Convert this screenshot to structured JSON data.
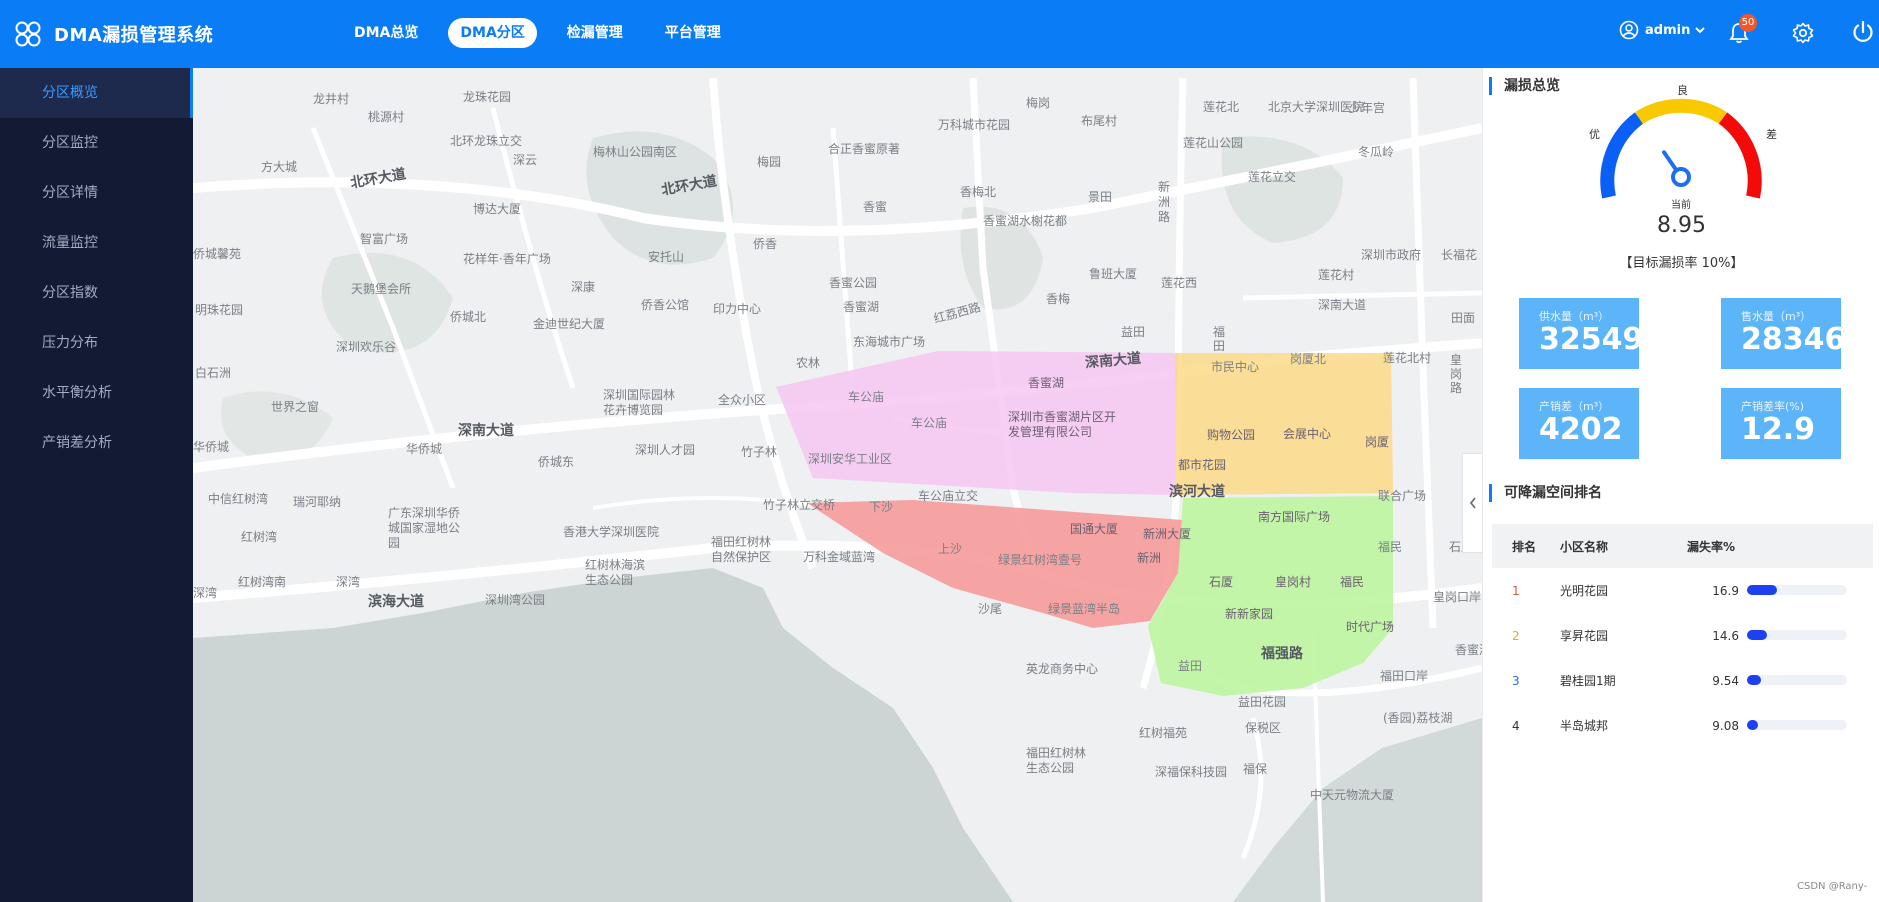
{
  "header": {
    "title": "DMA漏损管理系统",
    "nav": [
      "DMA总览",
      "DMA分区",
      "检漏管理",
      "平台管理"
    ],
    "active_nav": "DMA分区",
    "user": "admin",
    "notification_count": "50"
  },
  "sidebar": {
    "items": [
      "分区概览",
      "分区监控",
      "分区详情",
      "流量监控",
      "分区指数",
      "压力分布",
      "水平衡分析",
      "产销差分析"
    ],
    "active": "分区概览"
  },
  "map": {
    "labels": {
      "l1": "龙井村",
      "l2": "龙珠花园",
      "l3": "桃源村",
      "l4": "北环龙珠立交",
      "l5": "深云",
      "l6": "方大城",
      "l7": "北环大道",
      "l8": "博达大厦",
      "l9": "智富广场",
      "l10": "花样年·香年广场",
      "l11": "天鹅堡会所",
      "l12": "侨城北",
      "l13": "金迪世纪大厦",
      "l14": "深圳欢乐谷",
      "l15": "世界之窗",
      "l16": "深南大道",
      "l17": "华侨城",
      "l18": "侨城东",
      "l19": "中信红树湾",
      "l20": "瑞河耶纳",
      "l21": "红树湾",
      "l22": "广东深圳华侨城国家湿地公园",
      "l23": "红树湾南",
      "l24": "深湾",
      "l25": "滨海大道",
      "l26": "深圳湾公园",
      "l27": "香港大学深圳医院",
      "l28": "红树林海滨生态公园",
      "l29": "福田红树林自然保护区",
      "l30": "万科金域蓝湾",
      "l31": "竹子林立交桥",
      "l32": "梅林山公园南区",
      "l33": "梅园",
      "l34": "合正香蜜原著",
      "l35": "北环大道",
      "l36": "万科城市花园",
      "l37": "梅岗",
      "l38": "布尾村",
      "l39": "香蜜",
      "l40": "香梅北",
      "l41": "香蜜湖水榭花都",
      "l42": "景田",
      "l43": "新洲路",
      "l44": "安托山",
      "l45": "侨香",
      "l46": "深康",
      "l47": "侨香公馆",
      "l48": "印力中心",
      "l49": "香蜜公园",
      "l50": "香蜜湖",
      "l51": "红荔西路",
      "l52": "鲁班大厦",
      "l53": "香梅",
      "l54": "莲花西",
      "l55": "东海城市广场",
      "l56": "农林",
      "l57": "车公庙",
      "l58": "深圳国际园林花卉博览园",
      "l59": "全众小区",
      "l60": "深圳人才园",
      "l61": "竹子林",
      "l62": "深圳安华工业区",
      "l63": "车公庙立交",
      "l64": "下沙",
      "l65": "上沙",
      "l66": "绿景红树湾壹号",
      "l67": "沙尾",
      "l68": "绿景蓝湾半岛",
      "l69": "英龙商务中心",
      "l70": "益田",
      "l71": "福田",
      "l72": "市民中心",
      "l73": "岗厦北",
      "l74": "莲花北村",
      "l75": "莲花北",
      "l76": "北京大学深圳医院",
      "l77": "莲花山公园",
      "l78": "莲花立交",
      "l79": "冬瓜岭",
      "l80": "少年宫",
      "l81": "莲花村",
      "l82": "深圳市政府",
      "l83": "深南大道",
      "l84": "深南大道",
      "l85": "购物公园",
      "l86": "会展中心",
      "l87": "岗厦",
      "l88": "都市花园",
      "l89": "滨河大道",
      "l90": "联合广场",
      "l91": "国通大厦",
      "l92": "新洲大厦",
      "l93": "新洲",
      "l94": "南方国际广场",
      "l95": "石厦",
      "l96": "皇岗村",
      "l97": "福民",
      "l98": "新新家园",
      "l99": "时代广场",
      "l100": "福强路",
      "l101": "益田",
      "l102": "福田口岸",
      "l103": "益田花园",
      "l104": "红树福苑",
      "l105": "保税区",
      "l106": "福田红树林生态公园",
      "l107": "深福保科技园",
      "l108": "福保",
      "l109": "(香园)荔枝湖",
      "l110": "中天元物流大厦",
      "l111": "香蜜湖",
      "l112": "深圳市香蜜湖片区开发管理有限公司",
      "l113": "福民",
      "l114": "皇岗口岸",
      "l115": "长福花",
      "l116": "田面",
      "l117": "皇岗路",
      "l118": "石厦",
      "l119": "香蜜湖",
      "l120": "白石洲",
      "l121": "明珠花园",
      "l122": "侨城馨苑",
      "l123": "华侨城",
      "l124": "车公庙",
      "l125": "深湾"
    },
    "zones": [
      {
        "name": "zone-pink",
        "color": "#f6c6f2"
      },
      {
        "name": "zone-yellow",
        "color": "#fbd987"
      },
      {
        "name": "zone-red",
        "color": "#f59a9a"
      },
      {
        "name": "zone-green",
        "color": "#bdf59e"
      }
    ]
  },
  "panel": {
    "leak_title": "漏损总览",
    "gauge": {
      "labels": {
        "good": "优",
        "ok": "良",
        "bad": "差",
        "current": "当前"
      },
      "value": "8.95",
      "level": 0.35,
      "target": "【目标漏损率 10%】"
    },
    "cards": [
      {
        "label": "供水量（m³）",
        "value": "32549"
      },
      {
        "label": "售水量（m³）",
        "value": "28346"
      },
      {
        "label": "产销差（m³）",
        "value": "4202"
      },
      {
        "label": "产销差率(%)",
        "value": "12.9"
      }
    ],
    "rank_title": "可降漏空间排名",
    "table": {
      "headers": [
        "排名",
        "小区名称",
        "漏失率%"
      ],
      "rows": [
        {
          "rank": "1",
          "name": "光明花园",
          "rate": "16.9",
          "pct": 0.3,
          "color": "#e4553f"
        },
        {
          "rank": "2",
          "name": "享昇花园",
          "rate": "14.6",
          "pct": 0.2,
          "color": "#f5a623"
        },
        {
          "rank": "3",
          "name": "碧桂园1期",
          "rate": "9.54",
          "pct": 0.14,
          "color": "#1e6ff0"
        },
        {
          "rank": "4",
          "name": "半岛城邦",
          "rate": "9.08",
          "pct": 0.11,
          "color": "#333333"
        }
      ]
    }
  },
  "footer": {
    "credit": "CSDN @Rany-"
  }
}
